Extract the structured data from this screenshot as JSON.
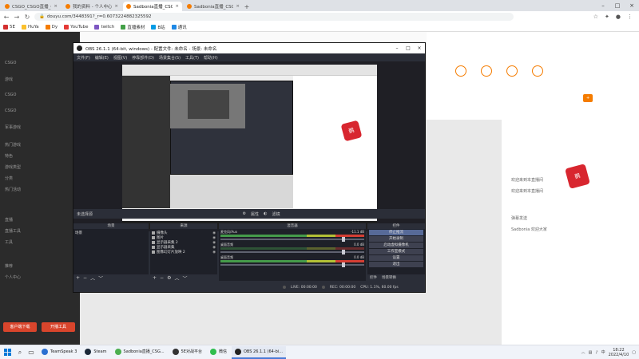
{
  "browser": {
    "tabs": [
      {
        "title": "CSGO_CSGO直播_CSGO游戏视",
        "active": false
      },
      {
        "title": "我的资料 - 个人中心 - 斗鱼",
        "active": false
      },
      {
        "title": "Sadbonia直播_CSGO直播_CSGO...",
        "active": true
      },
      {
        "title": "Sadbonia直播_CSGO直播_CSGO...",
        "active": false
      }
    ],
    "url": "douyu.com/3448391?_r=0.6073224882325592",
    "bookmarks": [
      {
        "label": "5E",
        "color": "#d32f2f"
      },
      {
        "label": "HuYa",
        "color": "#fbc02d"
      },
      {
        "label": "Dy",
        "color": "#f57c00"
      },
      {
        "label": "YouTube",
        "color": "#e53935"
      },
      {
        "label": "twitch",
        "color": "#7e57c2"
      },
      {
        "label": "直播素材",
        "color": "#43a047"
      },
      {
        "label": "B站",
        "color": "#039be5"
      },
      {
        "label": "通讯",
        "color": "#1e88e5"
      }
    ]
  },
  "site": {
    "left_rows": [
      "CSGO",
      "游戏",
      "CSGO",
      "CSGO",
      "军事游戏",
      "热门游戏",
      "特色",
      "游戏类型",
      "分类",
      "热门活动",
      "直播",
      "直播工具",
      "工具",
      "推荐",
      "个人中心"
    ],
    "buttons": [
      "客户端下载",
      "开播工具"
    ],
    "chat_lines": [
      "欢迎来到本直播间",
      "欢迎来到本直播间",
      "弹幕发送",
      "Sadbonia 欢迎大家"
    ]
  },
  "obs": {
    "title": "OBS 26.1.1 (64-bit, windows) - 配置文件: 未命名 - 场景: 未命名",
    "menu": [
      "文件(F)",
      "编辑(E)",
      "视图(V)",
      "停靠部件(D)",
      "场景集合(S)",
      "工具(T)",
      "帮助(H)"
    ],
    "scene_label": "未选择源",
    "props_label": "属性",
    "filters_label": "滤镜",
    "docks": {
      "scenes": {
        "title": "场景",
        "items": [
          "场景"
        ]
      },
      "sources": {
        "title": "来源",
        "items": [
          "摄像头",
          "图片",
          "显示器采集 2",
          "显示器采集",
          "图像幻灯片放映 2"
        ]
      },
      "mixer": {
        "title": "混音器",
        "channels": [
          {
            "name": "麦克风/Aux",
            "db": "-11.1 dB"
          },
          {
            "name": "桌面音频",
            "db": "0.0 dB"
          },
          {
            "name": "桌面音频",
            "db": "0.0 dB"
          }
        ]
      },
      "controls": {
        "title": "控件",
        "buttons": [
          "停止推流",
          "开始录制",
          "启动虚拟摄像机",
          "工作室模式",
          "设置",
          "退出"
        ],
        "tabs": [
          "控件",
          "场景转换"
        ]
      }
    },
    "status": {
      "live": "LIVE: 00:00:00",
      "rec": "REC: 00:00:00",
      "cpu": "CPU: 1.1%, 60.00 fps"
    }
  },
  "taskbar": {
    "apps": [
      {
        "label": "TeamSpeak 3",
        "color": "#2a6fd1",
        "active": false
      },
      {
        "label": "Steam",
        "color": "#1b2838",
        "active": false
      },
      {
        "label": "Sadbonia直播_CSG...",
        "color": "#4caf50",
        "active": false
      },
      {
        "label": "5E对战平台",
        "color": "#333333",
        "active": false
      },
      {
        "label": "微信",
        "color": "#2fbe4e",
        "active": false
      },
      {
        "label": "OBS 26.1.1 (64-bi...",
        "color": "#222222",
        "active": true
      }
    ],
    "time": "18:22",
    "date": "2022/4/10",
    "lang": "中"
  }
}
